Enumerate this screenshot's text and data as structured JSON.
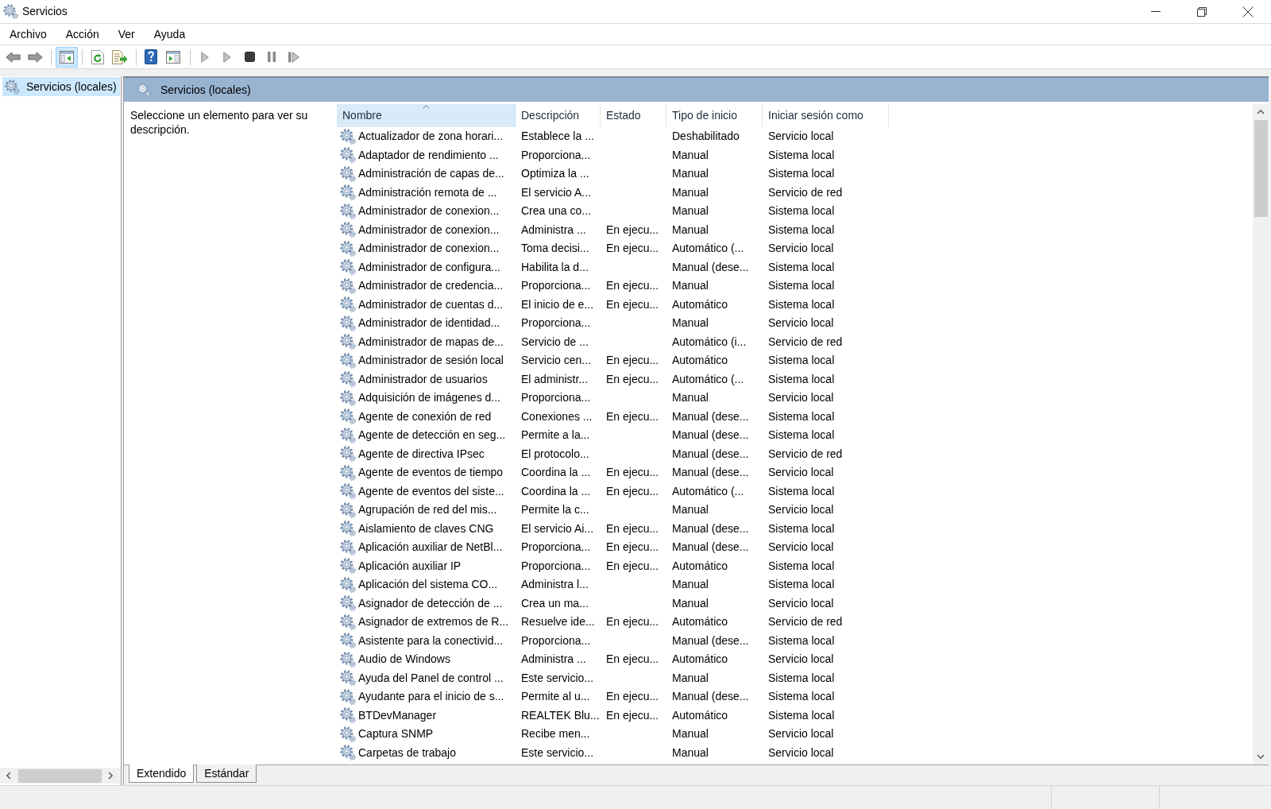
{
  "window": {
    "title": "Servicios"
  },
  "menu": [
    "Archivo",
    "Acción",
    "Ver",
    "Ayuda"
  ],
  "toolbar": {
    "tree_toggle_pressed": true
  },
  "tree": [
    {
      "label": "Servicios (locales)",
      "selected": true
    }
  ],
  "pane": {
    "title": "Servicios (locales)",
    "message": "Seleccione un elemento para ver su descripción."
  },
  "table": {
    "columns": [
      {
        "label": "Nombre",
        "sorted": true
      },
      {
        "label": "Descripción",
        "sorted": false
      },
      {
        "label": "Estado",
        "sorted": false
      },
      {
        "label": "Tipo de inicio",
        "sorted": false
      },
      {
        "label": "Iniciar sesión como",
        "sorted": false
      }
    ],
    "rows": [
      {
        "name": "Actualizador de zona horari...",
        "description": "Establece la ...",
        "startup_type": "Deshabilitado",
        "log_on_as": "Servicio local",
        "selected": false
      },
      {
        "name": "Adaptador de rendimiento ...",
        "description": "Proporciona...",
        "startup_type": "Manual",
        "log_on_as": "Sistema local",
        "selected": false
      },
      {
        "name": "Administración de capas de...",
        "description": "Optimiza la ...",
        "startup_type": "Manual",
        "log_on_as": "Sistema local",
        "selected": false
      },
      {
        "name": "Administración remota de ...",
        "description": "El servicio A...",
        "startup_type": "Manual",
        "log_on_as": "Servicio de red",
        "selected": false
      },
      {
        "name": "Administrador de conexion...",
        "description": "Crea una co...",
        "startup_type": "Manual",
        "log_on_as": "Sistema local",
        "selected": false
      },
      {
        "name": "Administrador de conexion...",
        "description": "Administra ...",
        "status": "En ejecu...",
        "startup_type": "Manual",
        "log_on_as": "Sistema local",
        "selected": false
      },
      {
        "name": "Administrador de conexion...",
        "description": "Toma decisi...",
        "status": "En ejecu...",
        "startup_type": "Automático (...",
        "log_on_as": "Servicio local",
        "selected": false
      },
      {
        "name": "Administrador de configura...",
        "description": "Habilita la d...",
        "startup_type": "Manual (dese...",
        "log_on_as": "Sistema local",
        "selected": false
      },
      {
        "name": "Administrador de credencia...",
        "description": "Proporciona...",
        "status": "En ejecu...",
        "startup_type": "Manual",
        "log_on_as": "Sistema local",
        "selected": false
      },
      {
        "name": "Administrador de cuentas d...",
        "description": "El inicio de e...",
        "status": "En ejecu...",
        "startup_type": "Automático",
        "log_on_as": "Sistema local",
        "selected": false
      },
      {
        "name": "Administrador de identidad...",
        "description": "Proporciona...",
        "startup_type": "Manual",
        "log_on_as": "Servicio local",
        "selected": false
      },
      {
        "name": "Administrador de mapas de...",
        "description": "Servicio de ...",
        "startup_type": "Automático (i...",
        "log_on_as": "Servicio de red",
        "selected": false
      },
      {
        "name": "Administrador de sesión local",
        "description": "Servicio cen...",
        "status": "En ejecu...",
        "startup_type": "Automático",
        "log_on_as": "Sistema local",
        "selected": false
      },
      {
        "name": "Administrador de usuarios",
        "description": "El administr...",
        "status": "En ejecu...",
        "startup_type": "Automático (...",
        "log_on_as": "Sistema local",
        "selected": false
      },
      {
        "name": "Adquisición de imágenes d...",
        "description": "Proporciona...",
        "startup_type": "Manual",
        "log_on_as": "Servicio local",
        "selected": false
      },
      {
        "name": "Agente de conexión de red",
        "description": "Conexiones ...",
        "status": "En ejecu...",
        "startup_type": "Manual (dese...",
        "log_on_as": "Sistema local",
        "selected": false
      },
      {
        "name": "Agente de detección en seg...",
        "description": "Permite a la...",
        "startup_type": "Manual (dese...",
        "log_on_as": "Sistema local",
        "selected": false
      },
      {
        "name": "Agente de directiva IPsec",
        "description": "El protocolo...",
        "startup_type": "Manual (dese...",
        "log_on_as": "Servicio de red",
        "selected": false
      },
      {
        "name": "Agente de eventos de tiempo",
        "description": "Coordina la ...",
        "status": "En ejecu...",
        "startup_type": "Manual (dese...",
        "log_on_as": "Servicio local",
        "selected": false
      },
      {
        "name": "Agente de eventos del siste...",
        "description": "Coordina la ...",
        "status": "En ejecu...",
        "startup_type": "Automático (...",
        "log_on_as": "Sistema local",
        "selected": false
      },
      {
        "name": "Agrupación de red del mis...",
        "description": "Permite la c...",
        "startup_type": "Manual",
        "log_on_as": "Servicio local",
        "selected": false
      },
      {
        "name": "Aislamiento de claves CNG",
        "description": "El servicio Ai...",
        "status": "En ejecu...",
        "startup_type": "Manual (dese...",
        "log_on_as": "Sistema local",
        "selected": false
      },
      {
        "name": "Aplicación auxiliar de NetBl...",
        "description": "Proporciona...",
        "status": "En ejecu...",
        "startup_type": "Manual (dese...",
        "log_on_as": "Servicio local",
        "selected": false
      },
      {
        "name": "Aplicación auxiliar IP",
        "description": "Proporciona...",
        "status": "En ejecu...",
        "startup_type": "Automático",
        "log_on_as": "Sistema local",
        "selected": false
      },
      {
        "name": "Aplicación del sistema CO...",
        "description": "Administra l...",
        "startup_type": "Manual",
        "log_on_as": "Sistema local",
        "selected": false
      },
      {
        "name": "Asignador de detección de ...",
        "description": "Crea un ma...",
        "startup_type": "Manual",
        "log_on_as": "Servicio local",
        "selected": false
      },
      {
        "name": "Asignador de extremos de R...",
        "description": "Resuelve ide...",
        "status": "En ejecu...",
        "startup_type": "Automático",
        "log_on_as": "Servicio de red",
        "selected": false
      },
      {
        "name": "Asistente para la conectivid...",
        "description": "Proporciona...",
        "startup_type": "Manual (dese...",
        "log_on_as": "Sistema local",
        "selected": false
      },
      {
        "name": "Audio de Windows",
        "description": "Administra ...",
        "status": "En ejecu...",
        "startup_type": "Automático",
        "log_on_as": "Servicio local",
        "selected": false
      },
      {
        "name": "Ayuda del Panel de control ...",
        "description": "Este servicio...",
        "startup_type": "Manual",
        "log_on_as": "Sistema local",
        "selected": false
      },
      {
        "name": "Ayudante para el inicio de s...",
        "description": "Permite al u...",
        "status": "En ejecu...",
        "startup_type": "Manual (dese...",
        "log_on_as": "Sistema local",
        "selected": false
      },
      {
        "name": "BTDevManager",
        "description": "REALTEK Blu...",
        "status": "En ejecu...",
        "startup_type": "Automático",
        "log_on_as": "Sistema local",
        "selected": false
      },
      {
        "name": "Captura SNMP",
        "description": "Recibe men...",
        "startup_type": "Manual",
        "log_on_as": "Servicio local",
        "selected": false
      },
      {
        "name": "Carpetas de trabajo",
        "description": "Este servicio...",
        "startup_type": "Manual",
        "log_on_as": "Servicio local",
        "selected": false
      }
    ]
  },
  "tabs": [
    {
      "label": "Extendido",
      "selected": true
    },
    {
      "label": "Estándar",
      "selected": false
    }
  ]
}
